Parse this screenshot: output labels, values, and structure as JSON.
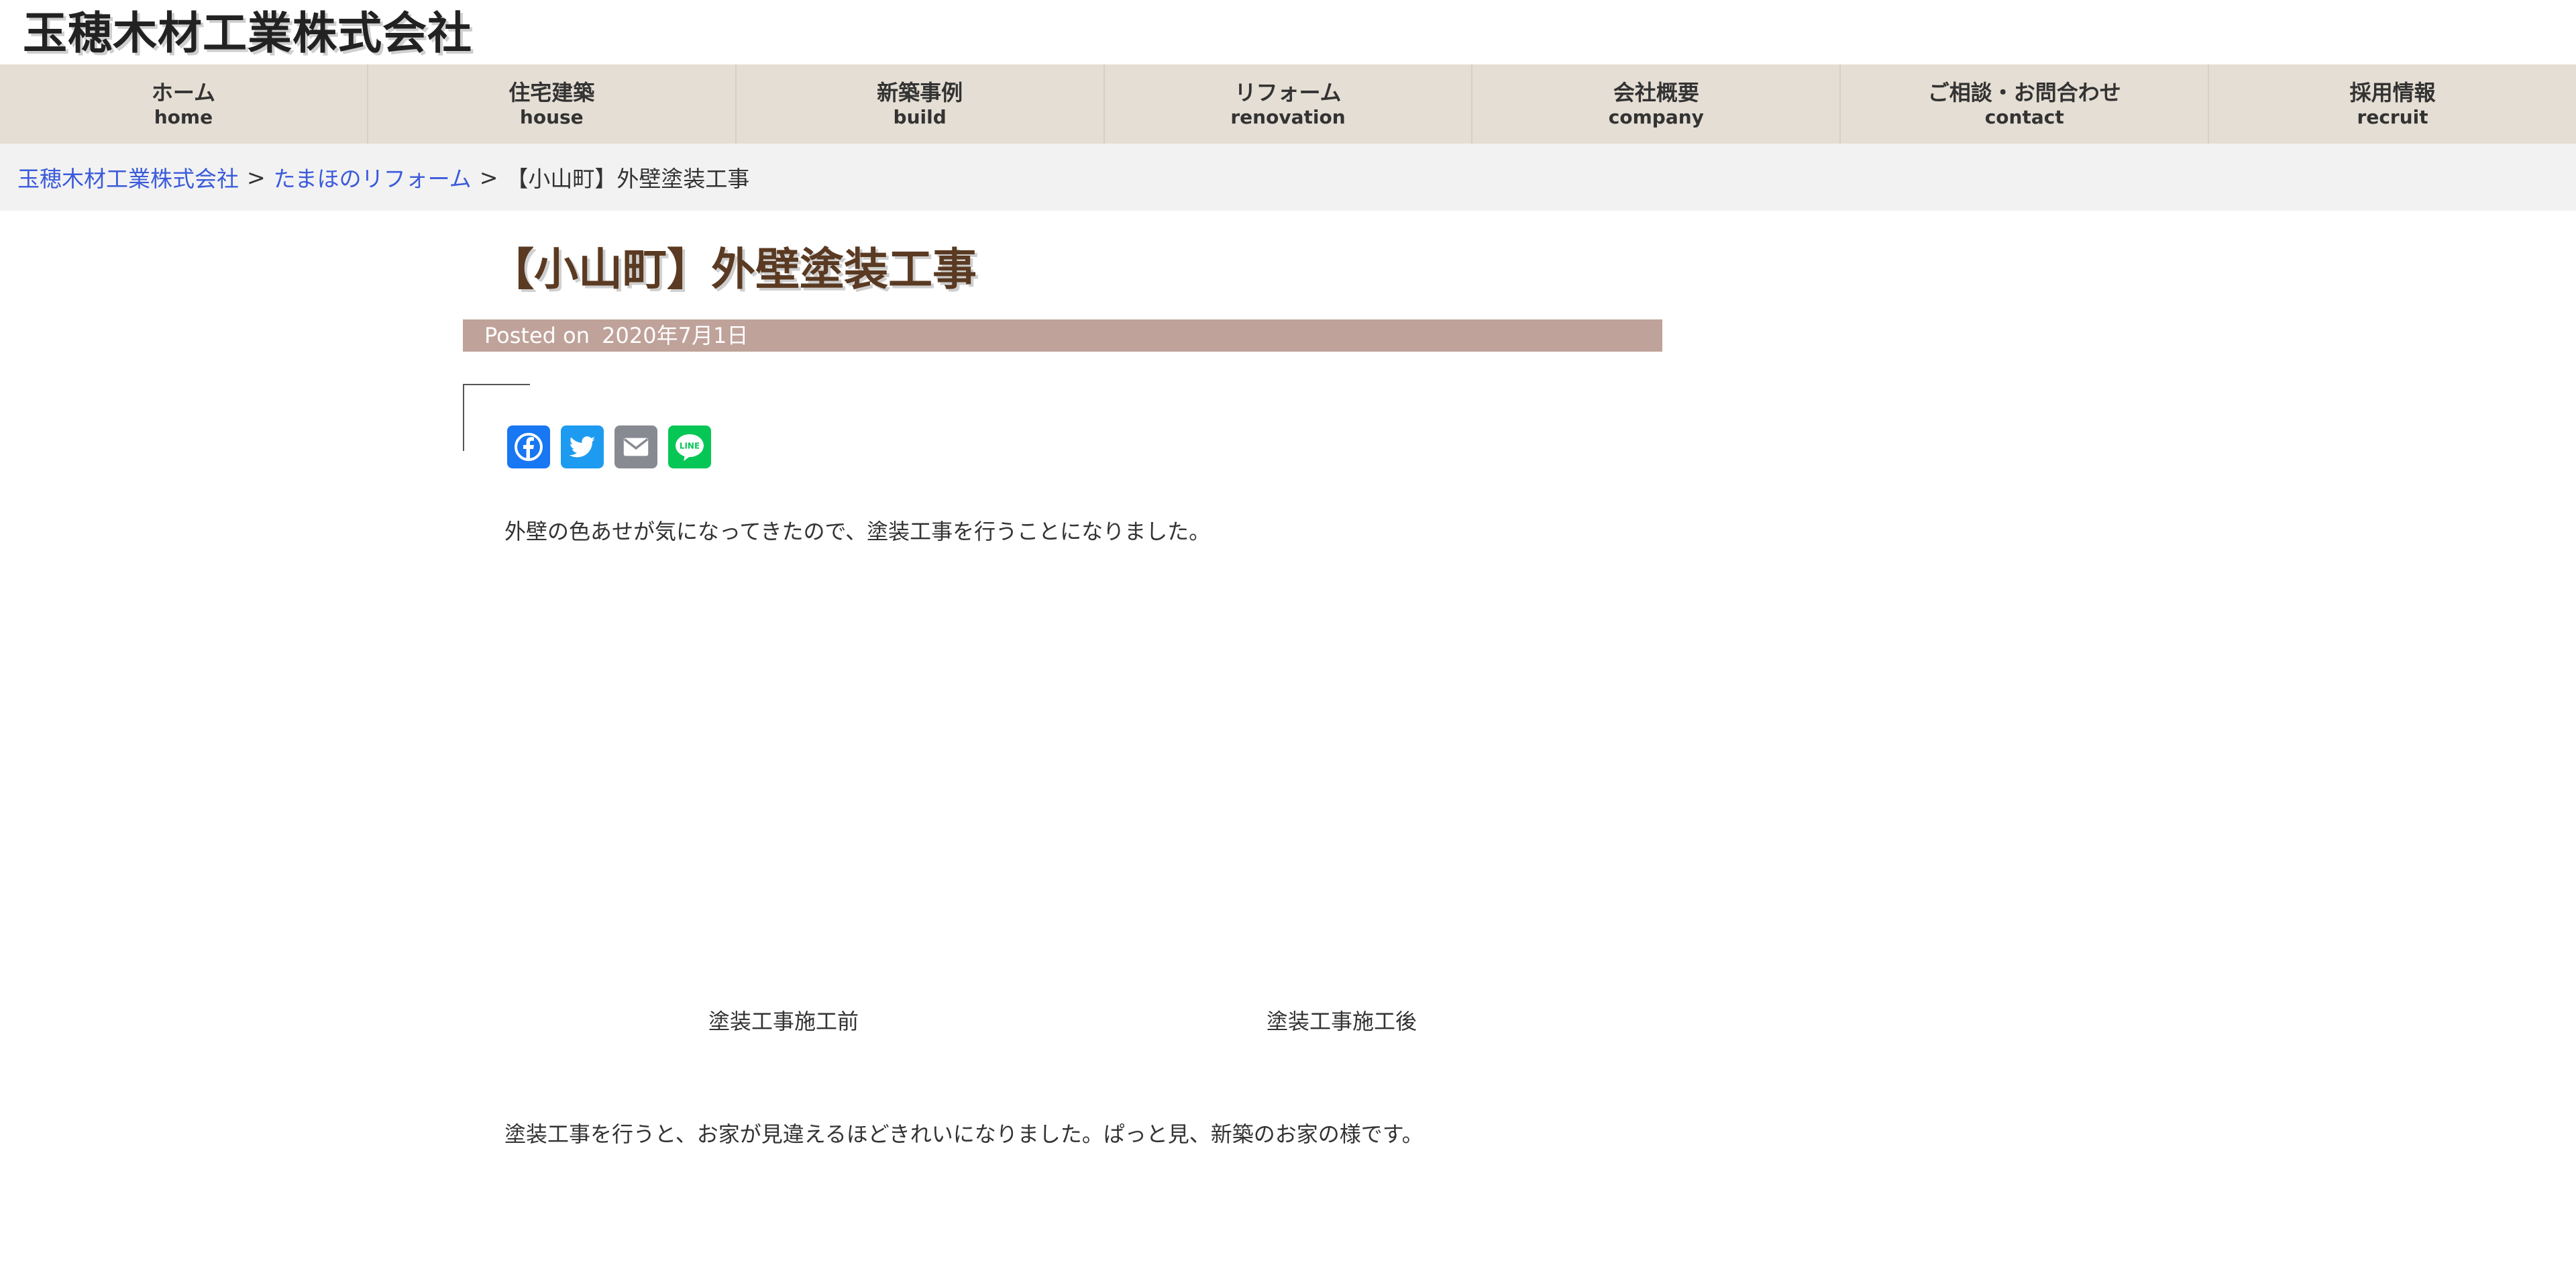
{
  "site": {
    "title": "玉穂木材工業株式会社"
  },
  "nav": {
    "items": [
      {
        "ja": "ホーム",
        "en": "home"
      },
      {
        "ja": "住宅建築",
        "en": "house"
      },
      {
        "ja": "新築事例",
        "en": "build"
      },
      {
        "ja": "リフォーム",
        "en": "renovation"
      },
      {
        "ja": "会社概要",
        "en": "company"
      },
      {
        "ja": "ご相談・お問合わせ",
        "en": "contact"
      },
      {
        "ja": "採用情報",
        "en": "recruit"
      }
    ],
    "background": "#e5ded4"
  },
  "breadcrumb": {
    "home": "玉穂木材工業株式会社",
    "category": "たまほのリフォーム",
    "separator": ">",
    "current": "【小山町】外壁塗装工事",
    "link_color": "#3b5bdb"
  },
  "article": {
    "title": "【小山町】外壁塗装工事",
    "posted_label": "Posted on",
    "posted_date": "2020年7月1日",
    "paragraph_1": "外壁の色あせが気になってきたので、塗装工事を行うことになりました。",
    "caption_before": "塗装工事施工前",
    "caption_after": "塗装工事施工後",
    "paragraph_2": "塗装工事を行うと、お家が見違えるほどきれいになりました。ぱっと見、新築のお家の様です。",
    "title_color": "#5a3a22",
    "posted_bar_color": "#bfa29a"
  },
  "share": {
    "buttons": [
      {
        "icon": "facebook-icon",
        "color": "#1877f2"
      },
      {
        "icon": "twitter-icon",
        "color": "#1d9bf0"
      },
      {
        "icon": "email-icon",
        "color": "#888a92"
      },
      {
        "icon": "line-icon",
        "color": "#06c755",
        "text": "LINE"
      }
    ]
  }
}
